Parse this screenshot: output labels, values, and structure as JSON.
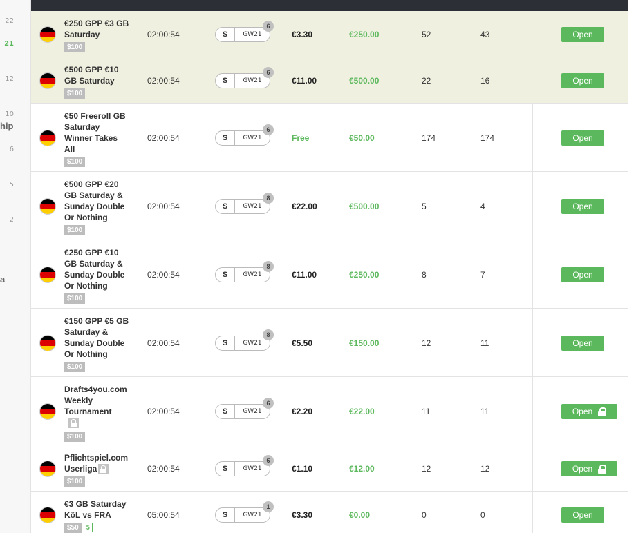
{
  "sidebar": {
    "numbers": [
      "22",
      "21",
      "12",
      "10",
      "6",
      "5",
      "2"
    ],
    "partial_texts": [
      "hip",
      "a"
    ]
  },
  "tags": {
    "s": "S",
    "gw": "GW21",
    "open": "Open"
  },
  "rows": [
    {
      "name": [
        "€250 GPP €3 GB",
        "Saturday"
      ],
      "tag": "$100",
      "time": "02:00:54",
      "badge": "6",
      "fee": "€3.30",
      "prize": "€250.00",
      "entries": "52",
      "spots": "43",
      "locked": false
    },
    {
      "name": [
        "€500 GPP €10",
        "GB Saturday"
      ],
      "tag": "$100",
      "time": "02:00:54",
      "badge": "6",
      "fee": "€11.00",
      "prize": "€500.00",
      "entries": "22",
      "spots": "16",
      "locked": false
    },
    {
      "name": [
        "€50 Freeroll GB",
        "Saturday",
        "Winner Takes",
        "All"
      ],
      "tag": "$100",
      "time": "02:00:54",
      "badge": "6",
      "fee": "Free",
      "prize": "€50.00",
      "entries": "174",
      "spots": "174",
      "locked": false
    },
    {
      "name": [
        "€500 GPP €20",
        "GB Saturday &",
        "Sunday Double",
        "Or Nothing"
      ],
      "tag": "$100",
      "time": "02:00:54",
      "badge": "8",
      "fee": "€22.00",
      "prize": "€500.00",
      "entries": "5",
      "spots": "4",
      "locked": false
    },
    {
      "name": [
        "€250 GPP €10",
        "GB Saturday &",
        "Sunday Double",
        "Or Nothing"
      ],
      "tag": "$100",
      "time": "02:00:54",
      "badge": "8",
      "fee": "€11.00",
      "prize": "€250.00",
      "entries": "8",
      "spots": "7",
      "locked": false
    },
    {
      "name": [
        "€150 GPP €5 GB",
        "Saturday &",
        "Sunday Double",
        "Or Nothing"
      ],
      "tag": "$100",
      "time": "02:00:54",
      "badge": "8",
      "fee": "€5.50",
      "prize": "€150.00",
      "entries": "12",
      "spots": "11",
      "locked": false
    },
    {
      "name": [
        "Drafts4you.com",
        "Weekly",
        "Tournament"
      ],
      "tag": "$100",
      "time": "02:00:54",
      "badge": "6",
      "fee": "€2.20",
      "prize": "€22.00",
      "entries": "11",
      "spots": "11",
      "locked": true
    },
    {
      "name": [
        "Pflichtspiel.com",
        "Userliga"
      ],
      "tag": "$100",
      "time": "02:00:54",
      "badge": "6",
      "fee": "€1.10",
      "prize": "€12.00",
      "entries": "12",
      "spots": "12",
      "locked": true
    },
    {
      "name": [
        "€3 GB Saturday",
        "KöL vs FRA"
      ],
      "tag": "$50",
      "tag2": "5",
      "time": "05:00:54",
      "badge": "1",
      "fee": "€3.30",
      "prize": "€0.00",
      "entries": "0",
      "spots": "0",
      "locked": false
    }
  ]
}
